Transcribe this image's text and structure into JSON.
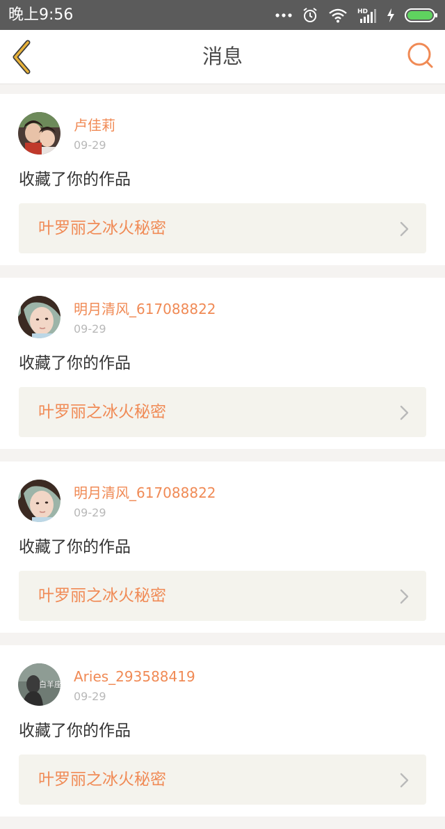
{
  "status_bar": {
    "time": "晚上9:56",
    "icons": [
      "more-dots-icon",
      "alarm-icon",
      "wifi-icon",
      "signal-hd-icon",
      "charging-icon",
      "battery-icon"
    ]
  },
  "header": {
    "title": "消息",
    "back_icon": "chevron-left-icon",
    "search_icon": "search-icon",
    "accent_color": "#f08a55",
    "back_color": "#e8b23a"
  },
  "messages": [
    {
      "username": "卢佳莉",
      "date": "09-29",
      "action": "收藏了你的作品",
      "work_title": "叶罗丽之冰火秘密"
    },
    {
      "username": "明月清风_617088822",
      "date": "09-29",
      "action": "收藏了你的作品",
      "work_title": "叶罗丽之冰火秘密"
    },
    {
      "username": "明月清风_617088822",
      "date": "09-29",
      "action": "收藏了你的作品",
      "work_title": "叶罗丽之冰火秘密"
    },
    {
      "username": "Aries_293588419",
      "date": "09-29",
      "action": "收藏了你的作品",
      "work_title": "叶罗丽之冰火秘密"
    }
  ]
}
